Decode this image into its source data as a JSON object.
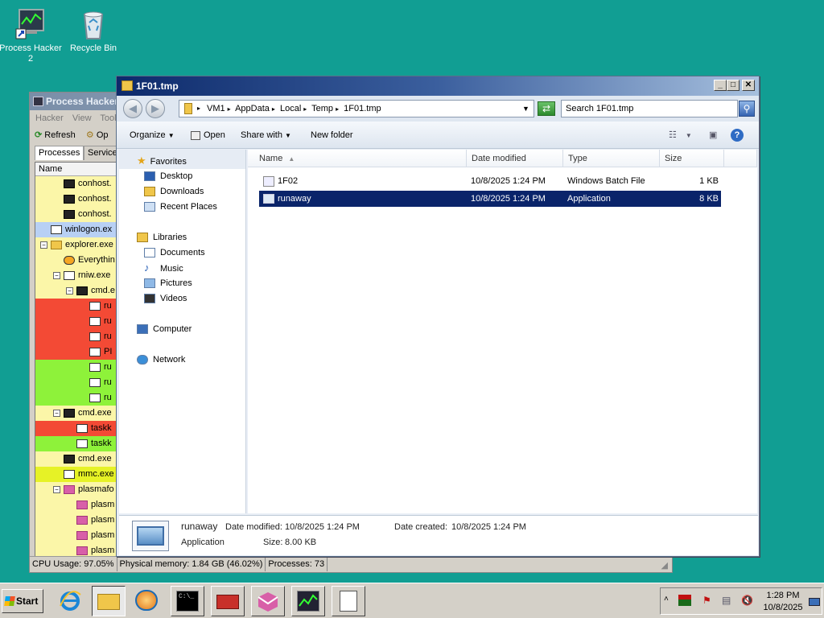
{
  "desktop": {
    "icons": [
      {
        "label": "Process Hacker 2",
        "icon": "process-hacker-icon"
      },
      {
        "label": "Recycle Bin",
        "icon": "recycle-bin-icon"
      }
    ]
  },
  "process_hacker": {
    "title": "Process Hacker",
    "menu": [
      "Hacker",
      "View",
      "Tool"
    ],
    "toolbar": {
      "refresh": "Refresh",
      "options": "Op"
    },
    "tabs": [
      "Processes",
      "Service"
    ],
    "column_name": "Name",
    "processes": [
      {
        "name": "conhost.",
        "indent": 1,
        "bg": "#fbf6a8",
        "icon": "console"
      },
      {
        "name": "conhost.",
        "indent": 1,
        "bg": "#fbf6a8",
        "icon": "console"
      },
      {
        "name": "conhost.",
        "indent": 1,
        "bg": "#fbf6a8",
        "icon": "console"
      },
      {
        "name": "winlogon.ex",
        "indent": 0,
        "bg": "#b8d0f4",
        "icon": "app"
      },
      {
        "name": "explorer.exe",
        "indent": 0,
        "bg": "#fbf6a8",
        "icon": "folder",
        "toggle": "−"
      },
      {
        "name": "Everythin",
        "indent": 1,
        "bg": "#fbf6a8",
        "icon": "search"
      },
      {
        "name": "rniw.exe",
        "indent": 1,
        "bg": "#fbf6a8",
        "icon": "app",
        "toggle": "−"
      },
      {
        "name": "cmd.e",
        "indent": 2,
        "bg": "#fbf6a8",
        "icon": "console",
        "toggle": "−"
      },
      {
        "name": "ru",
        "indent": 3,
        "bg": "#f34a35",
        "icon": "app"
      },
      {
        "name": "ru",
        "indent": 3,
        "bg": "#f34a35",
        "icon": "app"
      },
      {
        "name": "ru",
        "indent": 3,
        "bg": "#f34a35",
        "icon": "app"
      },
      {
        "name": "PI",
        "indent": 3,
        "bg": "#f34a35",
        "icon": "app"
      },
      {
        "name": "ru",
        "indent": 3,
        "bg": "#8ef23a",
        "icon": "app"
      },
      {
        "name": "ru",
        "indent": 3,
        "bg": "#8ef23a",
        "icon": "app"
      },
      {
        "name": "ru",
        "indent": 3,
        "bg": "#8ef23a",
        "icon": "app"
      },
      {
        "name": "cmd.exe",
        "indent": 1,
        "bg": "#fbf6a8",
        "icon": "console",
        "toggle": "−"
      },
      {
        "name": "taskk",
        "indent": 2,
        "bg": "#f34a35",
        "icon": "app"
      },
      {
        "name": "taskk",
        "indent": 2,
        "bg": "#8ef23a",
        "icon": "app"
      },
      {
        "name": "cmd.exe",
        "indent": 1,
        "bg": "#fbf6a8",
        "icon": "console"
      },
      {
        "name": "mmc.exe",
        "indent": 1,
        "bg": "#e6f226",
        "icon": "app"
      },
      {
        "name": "plasmafo",
        "indent": 1,
        "bg": "#fbf6a8",
        "icon": "plasma",
        "toggle": "−"
      },
      {
        "name": "plasm",
        "indent": 2,
        "bg": "#fbf6a8",
        "icon": "plasma"
      },
      {
        "name": "plasm",
        "indent": 2,
        "bg": "#fbf6a8",
        "icon": "plasma"
      },
      {
        "name": "plasm",
        "indent": 2,
        "bg": "#fbf6a8",
        "icon": "plasma"
      },
      {
        "name": "plasm",
        "indent": 2,
        "bg": "#fbf6a8",
        "icon": "plasma"
      }
    ],
    "status": {
      "cpu": "CPU Usage: 97.05%",
      "memory": "Physical memory: 1.84 GB (46.02%)",
      "processes": "Processes: 73"
    }
  },
  "explorer": {
    "title": "1F01.tmp",
    "breadcrumb": [
      "VM1",
      "AppData",
      "Local",
      "Temp",
      "1F01.tmp"
    ],
    "search_placeholder": "Search 1F01.tmp",
    "commands": {
      "organize": "Organize",
      "open": "Open",
      "share": "Share with",
      "new_folder": "New folder"
    },
    "nav": {
      "favorites": "Favorites",
      "desktop": "Desktop",
      "downloads": "Downloads",
      "recent": "Recent Places",
      "libraries": "Libraries",
      "documents": "Documents",
      "music": "Music",
      "pictures": "Pictures",
      "videos": "Videos",
      "computer": "Computer",
      "network": "Network"
    },
    "columns": {
      "name": "Name",
      "date": "Date modified",
      "type": "Type",
      "size": "Size"
    },
    "files": [
      {
        "name": "1F02",
        "date": "10/8/2025 1:24 PM",
        "type": "Windows Batch File",
        "size": "1 KB",
        "selected": false
      },
      {
        "name": "runaway",
        "date": "10/8/2025 1:24 PM",
        "type": "Application",
        "size": "8 KB",
        "selected": true
      }
    ],
    "details": {
      "name": "runaway",
      "type": "Application",
      "modified_label": "Date modified:",
      "modified": "10/8/2025 1:24 PM",
      "created_label": "Date created:",
      "created": "10/8/2025 1:24 PM",
      "size_label": "Size:",
      "size": "8.00 KB"
    }
  },
  "taskbar": {
    "start": "Start",
    "time": "1:28 PM",
    "date": "10/8/2025"
  }
}
